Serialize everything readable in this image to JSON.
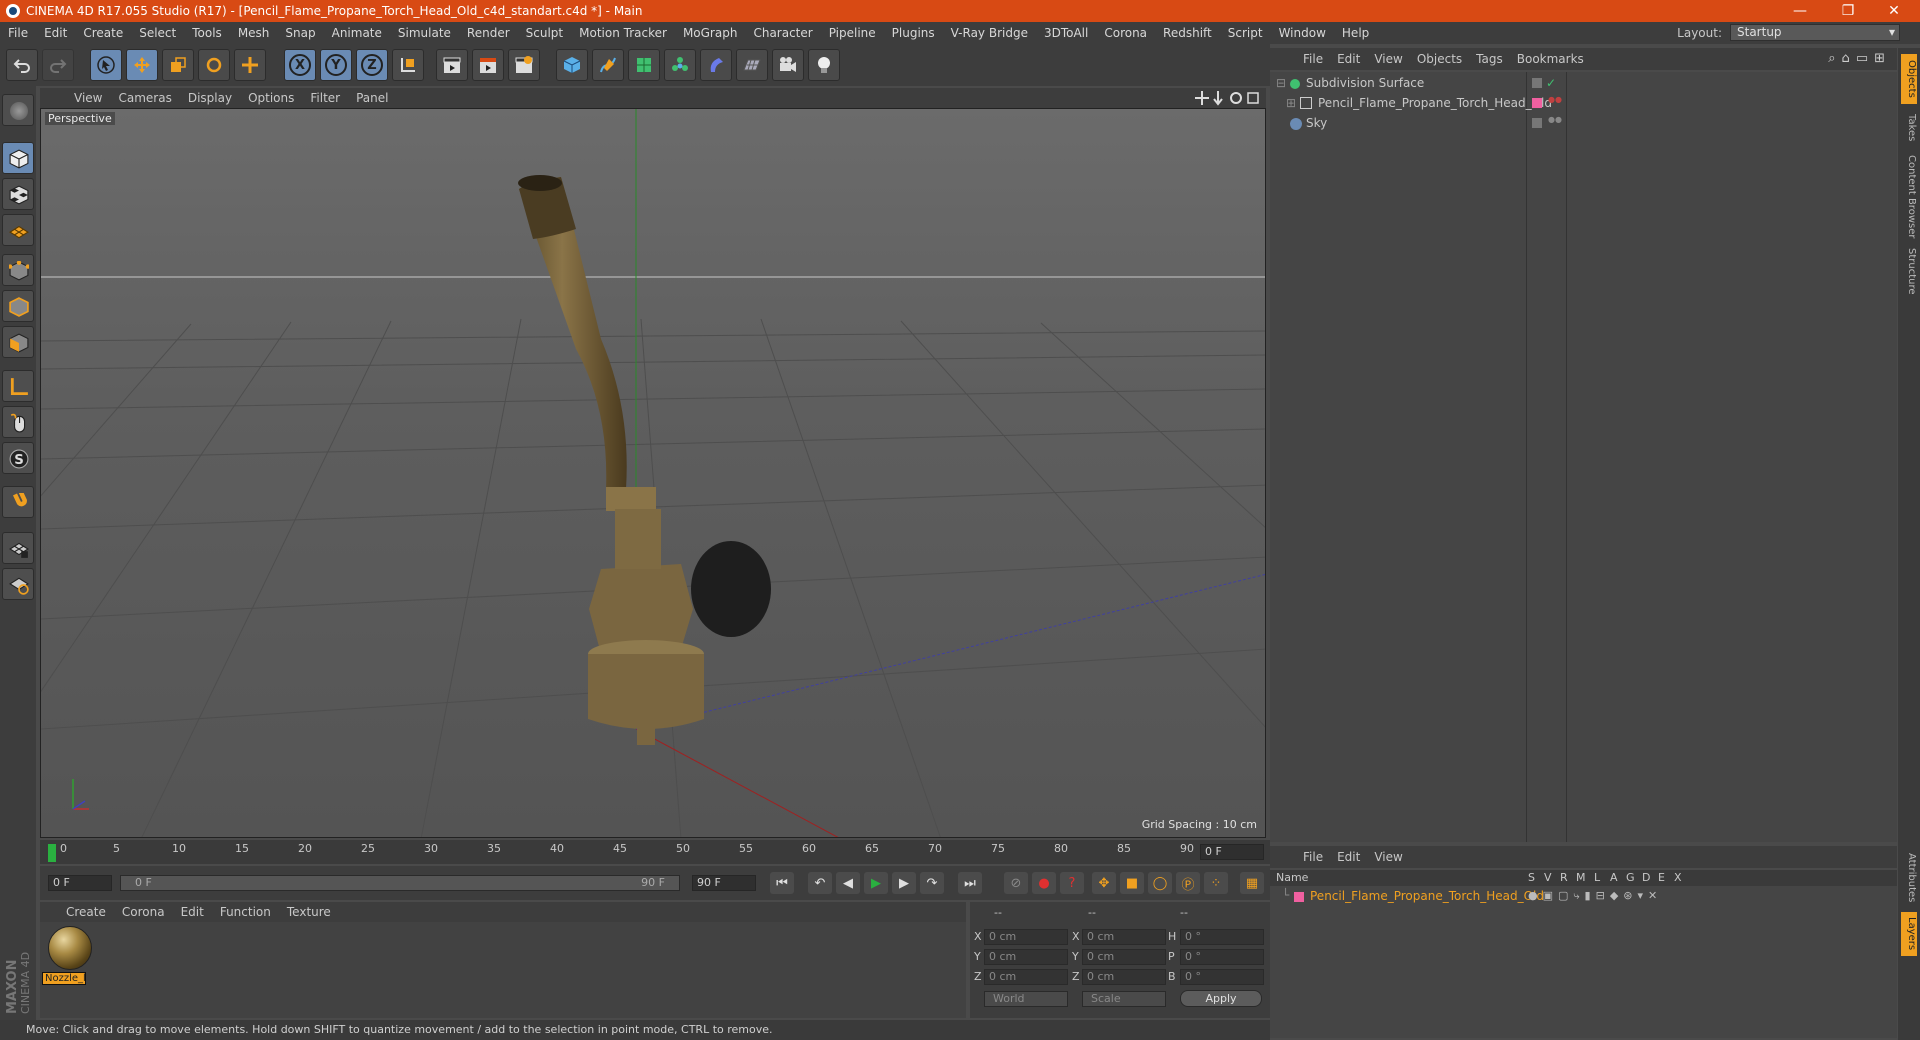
{
  "window": {
    "title": "CINEMA 4D R17.055 Studio (R17) - [Pencil_Flame_Propane_Torch_Head_Old_c4d_standart.c4d *] - Main",
    "minimize": "—",
    "maximize": "❐",
    "close": "✕"
  },
  "menubar": [
    "File",
    "Edit",
    "Create",
    "Select",
    "Tools",
    "Mesh",
    "Snap",
    "Animate",
    "Simulate",
    "Render",
    "Sculpt",
    "Motion Tracker",
    "MoGraph",
    "Character",
    "Pipeline",
    "Plugins",
    "V-Ray Bridge",
    "3DToAll",
    "Corona",
    "Redshift",
    "Script",
    "Window",
    "Help"
  ],
  "layout": {
    "label": "Layout:",
    "value": "Startup"
  },
  "toolbar": {
    "axis_x": "X",
    "axis_y": "Y",
    "axis_z": "Z"
  },
  "viewport": {
    "menu": [
      "View",
      "Cameras",
      "Display",
      "Options",
      "Filter",
      "Panel"
    ],
    "label": "Perspective",
    "grid_spacing": "Grid Spacing : 10 cm"
  },
  "timeline": {
    "ticks": [
      "0",
      "5",
      "10",
      "15",
      "20",
      "25",
      "30",
      "35",
      "40",
      "45",
      "50",
      "55",
      "60",
      "65",
      "70",
      "75",
      "80",
      "85",
      "90"
    ],
    "current_frame": "0 F"
  },
  "playback": {
    "start": "0 F",
    "range_start": "0 F",
    "range_end": "90 F",
    "end": "90 F"
  },
  "material_manager": {
    "menu": [
      "Create",
      "Corona",
      "Edit",
      "Function",
      "Texture"
    ],
    "material_name": "Nozzle_l"
  },
  "coordinates": {
    "headers": [
      "--",
      "--",
      "--"
    ],
    "rows": [
      {
        "a": "X",
        "av": "0 cm",
        "b": "X",
        "bv": "0 cm",
        "c": "H",
        "cv": "0 °"
      },
      {
        "a": "Y",
        "av": "0 cm",
        "b": "Y",
        "bv": "0 cm",
        "c": "P",
        "cv": "0 °"
      },
      {
        "a": "Z",
        "av": "0 cm",
        "b": "Z",
        "bv": "0 cm",
        "c": "B",
        "cv": "0 °"
      }
    ],
    "mode": "World",
    "scale": "Scale",
    "apply": "Apply"
  },
  "status": "Move: Click and drag to move elements. Hold down SHIFT to quantize movement / add to the selection in point mode, CTRL to remove.",
  "object_manager": {
    "menu": [
      "File",
      "Edit",
      "View",
      "Objects",
      "Tags",
      "Bookmarks"
    ],
    "objects": [
      {
        "name": "Subdivision Surface"
      },
      {
        "name": "Pencil_Flame_Propane_Torch_Head_Old"
      },
      {
        "name": "Sky"
      }
    ]
  },
  "layer_manager": {
    "menu": [
      "File",
      "Edit",
      "View"
    ],
    "columns": [
      "Name",
      "S",
      "V",
      "R",
      "M",
      "L",
      "A",
      "G",
      "D",
      "E",
      "X"
    ],
    "layers": [
      {
        "name": "Pencil_Flame_Propane_Torch_Head_Old",
        "color": "#f060a0"
      }
    ]
  },
  "right_tabs": [
    "Objects",
    "Takes",
    "Content Browser",
    "Structure",
    "Attributes",
    "Layers"
  ],
  "brand": {
    "maxon": "MAXON",
    "c4d": "CINEMA 4D"
  },
  "colors": {
    "accent": "#d84a14",
    "highlight": "#f0a020",
    "selection": "#6a8bb4"
  }
}
